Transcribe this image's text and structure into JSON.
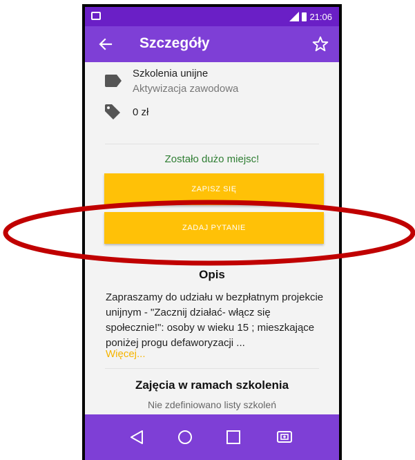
{
  "status_bar": {
    "time": "21:06"
  },
  "app_bar": {
    "title": "Szczegóły"
  },
  "details": {
    "category_main": "Szkolenia unijne",
    "category_sub": "Aktywizacja zawodowa",
    "price": "0 zł"
  },
  "availability": "Zostało dużo miejsc!",
  "buttons": {
    "signup_label": "ZAPISZ SIĘ",
    "ask_label": "ZADAJ PYTANIE"
  },
  "description": {
    "title": "Opis",
    "text": "Zapraszamy do udziału w bezpłatnym projekcie unijnym - \"Zacznij działać- włącz się społecznie!\": osoby w wieku 15 ; mieszkające poniżej progu defaworyzacji ...",
    "more_label": "Więcej..."
  },
  "classes": {
    "title": "Zajęcia w ramach szkolenia",
    "empty_text": "Nie zdefiniowano listy szkoleń"
  },
  "colors": {
    "status_bar": "#6a1fc6",
    "app_bar": "#7e3fd6",
    "button": "#ffc107",
    "availability_text": "#2e7d32",
    "link": "#f5b400",
    "annotation": "#c00000"
  },
  "icons": {
    "back": "arrow-left-icon",
    "favorite": "star-outline-icon",
    "category": "label-icon",
    "price": "tag-icon",
    "nav_back": "triangle-back-icon",
    "nav_home": "circle-home-icon",
    "nav_recents": "square-recents-icon",
    "nav_screen": "screen-mirror-icon"
  }
}
